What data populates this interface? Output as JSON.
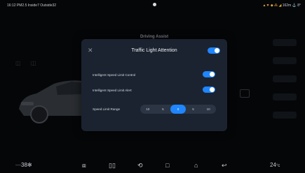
{
  "status_bar": {
    "left_text": "16:12 PM2.5 Inside7 Outside32",
    "right_text": "162m",
    "right_prefix": "▲▼ ◆ ⁂ ◢",
    "right_suffix": "⚓ 8°"
  },
  "background": {
    "tabs": [
      {
        "label": "Driving Assist"
      },
      {
        "label": ""
      },
      {
        "label": ""
      }
    ]
  },
  "dialog": {
    "title": "Traffic Light Attention",
    "title_toggle_on": true,
    "close_glyph": "✕",
    "rows": [
      {
        "label": "Intelligent Speed Limit Control",
        "on": true
      },
      {
        "label": "Intelligent Speed Limit Alert",
        "on": true
      }
    ],
    "speed_range": {
      "label": "Speed Limit Range",
      "options": [
        "10",
        "5",
        "0",
        "5",
        "10"
      ],
      "selected_index": 2
    }
  },
  "bottom_bar": {
    "left_temp": "38",
    "left_fan_icon": "fan-icon",
    "right_temp": "24",
    "right_unit": "°c",
    "icons": [
      "mirror-icon",
      "seat-heat-icon",
      "steering-icon",
      "square-icon",
      "home-icon",
      "back-icon"
    ]
  },
  "colors": {
    "accent": "#1f86ff",
    "dialog_bg": "#1b2330",
    "page_bg": "#050608"
  }
}
